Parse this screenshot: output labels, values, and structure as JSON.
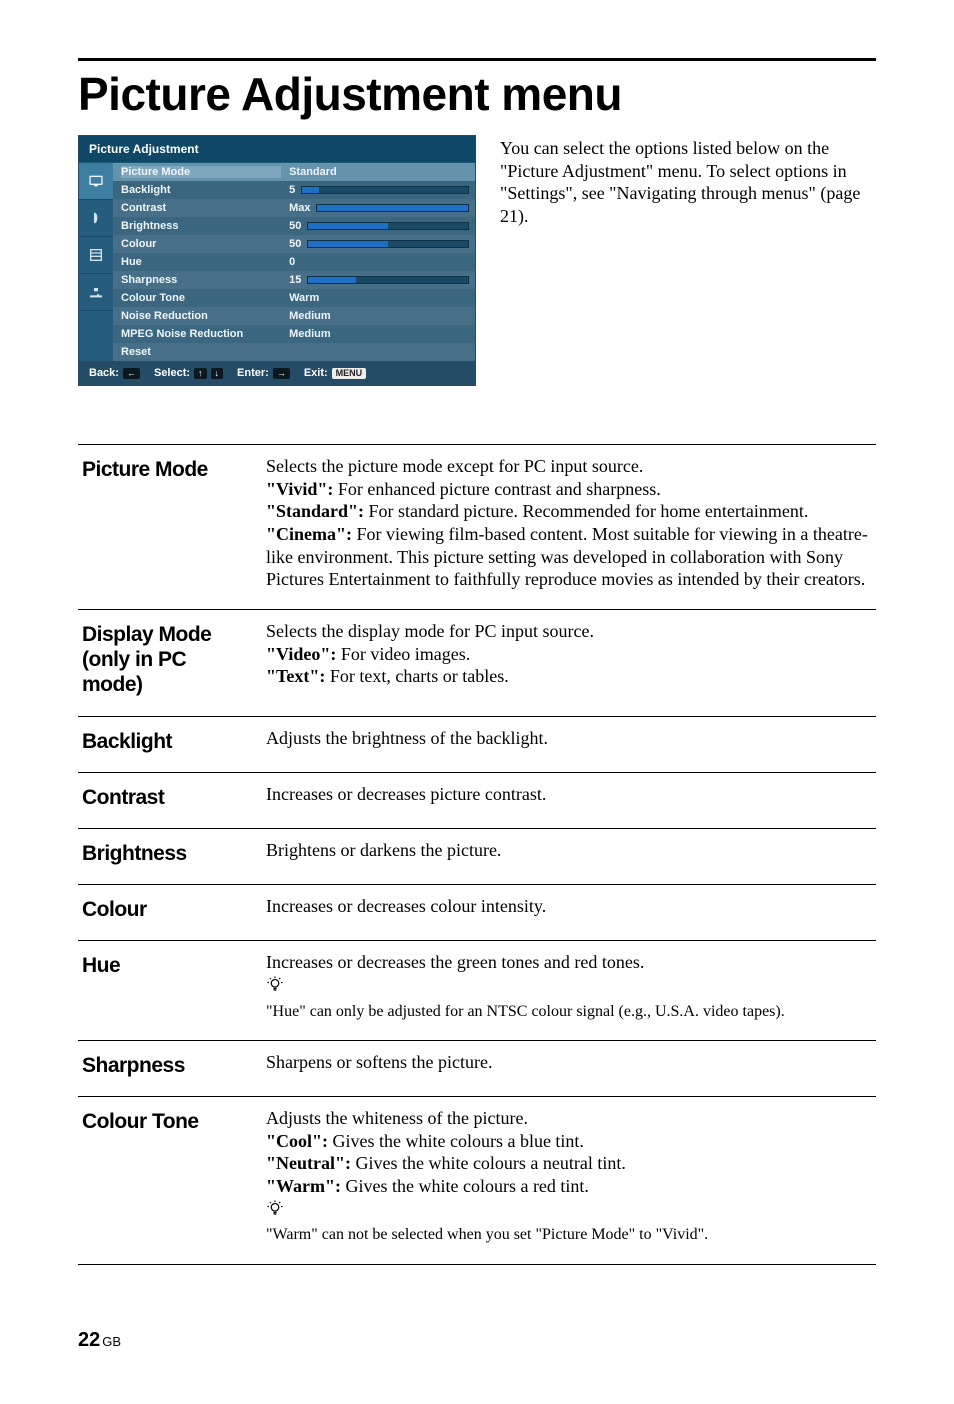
{
  "heading": "Picture Adjustment menu",
  "intro": "You can select the options listed below on the \"Picture Adjustment\" menu. To select options in \"Settings\", see \"Navigating through menus\" (page 21).",
  "osd": {
    "title": "Picture Adjustment",
    "rows": [
      {
        "label": "Picture Mode",
        "value": "Standard",
        "slider": null,
        "selected": true
      },
      {
        "label": "Backlight",
        "value": "5",
        "slider": 10
      },
      {
        "label": "Contrast",
        "value": "Max",
        "slider": 100
      },
      {
        "label": "Brightness",
        "value": "50",
        "slider": 50
      },
      {
        "label": "Colour",
        "value": "50",
        "slider": 50
      },
      {
        "label": "Hue",
        "value": "0",
        "slider": null
      },
      {
        "label": "Sharpness",
        "value": "15",
        "slider": 30
      },
      {
        "label": "Colour Tone",
        "value": "Warm",
        "slider": null
      },
      {
        "label": "Noise Reduction",
        "value": "Medium",
        "slider": null
      },
      {
        "label": "MPEG Noise Reduction",
        "value": "Medium",
        "slider": null
      },
      {
        "label": "Reset",
        "value": "",
        "slider": null
      }
    ],
    "footer": {
      "back": "Back:",
      "select": "Select:",
      "enter": "Enter:",
      "exit": "Exit:",
      "menu": "MENU"
    }
  },
  "definitions": [
    {
      "term": "Picture Mode",
      "desc_html": "Selects the picture mode except for PC input source.<br><b>\"Vivid\":</b> For enhanced picture contrast and sharpness.<br><b>\"Standard\":</b> For standard picture. Recommended for home entertainment.<br><b>\"Cinema\":</b> For viewing film-based content. Most suitable for viewing in a theatre-like environment. This picture setting was developed in collaboration with Sony Pictures Entertainment to faithfully reproduce movies as intended by their creators."
    },
    {
      "term": "Display Mode (only in PC mode)",
      "desc_html": "Selects the display mode for PC input source.<br><b>\"Video\":</b> For video images.<br><b>\"Text\":</b> For text, charts or tables."
    },
    {
      "term": "Backlight",
      "desc_html": "Adjusts the brightness of the backlight."
    },
    {
      "term": "Contrast",
      "desc_html": "Increases or decreases picture contrast."
    },
    {
      "term": "Brightness",
      "desc_html": "Brightens or darkens the picture."
    },
    {
      "term": "Colour",
      "desc_html": "Increases or decreases colour intensity."
    },
    {
      "term": "Hue",
      "desc_html": "Increases or decreases the green tones and red tones.",
      "tip_html": "\"Hue\" can only be adjusted for an NTSC colour signal (e.g., U.S.A. video tapes)."
    },
    {
      "term": "Sharpness",
      "desc_html": "Sharpens or softens the picture."
    },
    {
      "term": "Colour Tone",
      "desc_html": "Adjusts the whiteness of the picture.<br><b>\"Cool\":</b> Gives the white colours a blue tint.<br><b>\"Neutral\":</b> Gives the white colours a neutral tint.<br><b>\"Warm\":</b> Gives the white colours a red tint.",
      "tip_html": "\"Warm\" can not be selected when you set \"Picture Mode\" to \"Vivid\"."
    }
  ],
  "footer": {
    "page": "22",
    "region": "GB"
  }
}
